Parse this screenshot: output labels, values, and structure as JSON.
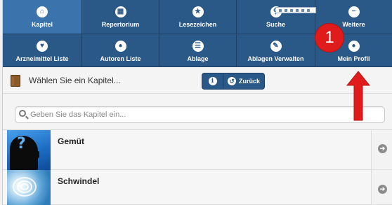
{
  "nav": {
    "row1": [
      {
        "label": "Kapitel",
        "icon": "home-icon",
        "glyph": "⌂",
        "active": true
      },
      {
        "label": "Repertorium",
        "icon": "grid-icon",
        "glyph": "▦",
        "active": false
      },
      {
        "label": "Lesezeichen",
        "icon": "star-icon",
        "glyph": "★",
        "active": false
      },
      {
        "label": "Suche",
        "icon": "search-icon",
        "glyph": "⚲",
        "active": false
      },
      {
        "label": "Weitere",
        "icon": "minus-icon",
        "glyph": "−",
        "active": false
      }
    ],
    "row2": [
      {
        "label": "Arzneimittel Liste",
        "icon": "heart-icon",
        "glyph": "♥"
      },
      {
        "label": "Autoren Liste",
        "icon": "user-icon",
        "glyph": "●"
      },
      {
        "label": "Ablage",
        "icon": "list-icon",
        "glyph": "☰"
      },
      {
        "label": "Ablagen Verwalten",
        "icon": "pencil-icon",
        "glyph": "✎"
      },
      {
        "label": "Mein Profil",
        "icon": "user-icon",
        "glyph": "●"
      }
    ]
  },
  "toolbar": {
    "chapter_prompt": "Wählen Sie ein Kapitel...",
    "info_glyph": "i",
    "back_glyph": "↺",
    "back_label": "Zurück"
  },
  "search": {
    "placeholder": "Geben Sie das Kapitel ein..."
  },
  "chapters": [
    {
      "title": "Gemüt",
      "thumb_glyph": "?"
    },
    {
      "title": "Schwindel"
    }
  ],
  "arrow_glyph": "➔",
  "callout": {
    "number": "1",
    "color": "#e01b1b"
  },
  "colors": {
    "nav_bg": "#2a5887",
    "nav_active": "#3b74ad",
    "callout_red": "#e01b1b"
  }
}
